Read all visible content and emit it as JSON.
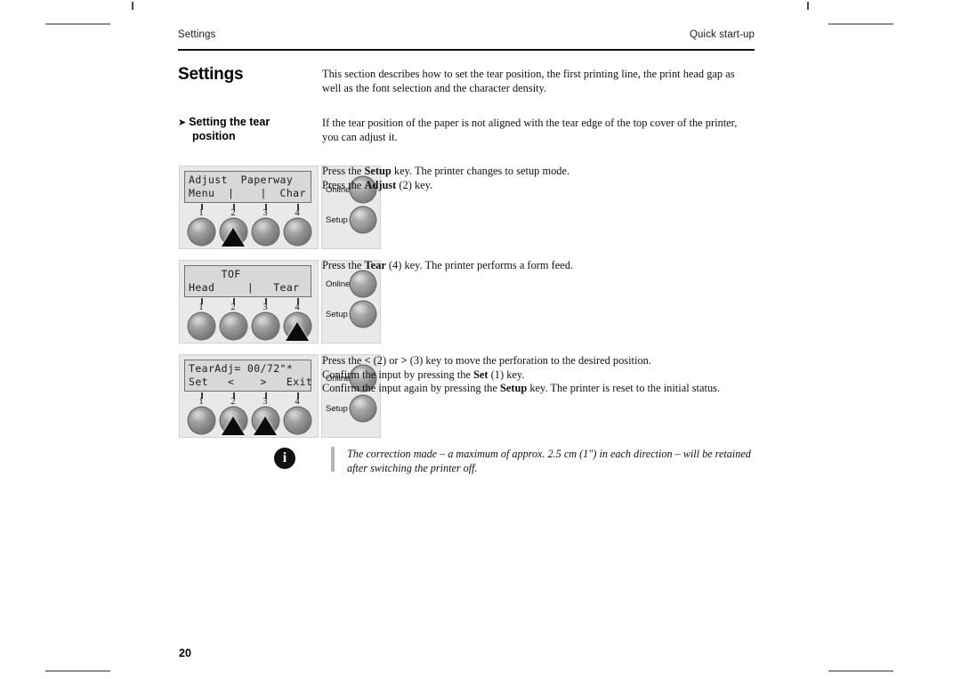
{
  "header": {
    "left": "Settings",
    "right": "Quick start-up"
  },
  "page_title": "Settings",
  "intro_text": "This section describes how to set the tear position, the first printing line, the print head gap as well as the font selection and the character density.",
  "section": {
    "arrow_glyph": "➤",
    "label_line1": "Setting the tear",
    "label_line2": "position",
    "description": "If the tear position of the paper is not aligned with the tear edge of the top cover of the printer, you can adjust it."
  },
  "steps": [
    {
      "panel": {
        "lcd_line1": "Adjust  Paperway",
        "lcd_line2": "Menu  |    |  Char",
        "button_numbers": [
          "1",
          "2",
          "3",
          "4"
        ],
        "pressed_button": "2",
        "side_buttons": [
          "Online",
          "Setup"
        ]
      },
      "instructions": [
        {
          "pre": "Press the ",
          "bold": "Setup",
          "post": " key. The printer changes to setup mode."
        },
        {
          "pre": "Press the ",
          "bold": "Adjust",
          "post": " (2) key."
        }
      ]
    },
    {
      "panel": {
        "lcd_line1": "     TOF",
        "lcd_line2": "Head     |   Tear",
        "button_numbers": [
          "1",
          "2",
          "3",
          "4"
        ],
        "pressed_button": "4",
        "side_buttons": [
          "Online",
          "Setup"
        ]
      },
      "instructions": [
        {
          "pre": "Press the ",
          "bold": "Tear",
          "post": " (4) key. The printer performs a form feed."
        }
      ]
    },
    {
      "panel": {
        "lcd_line1": "TearAdj= 00/72\"*",
        "lcd_line2": "Set   <    >   Exit",
        "button_numbers": [
          "1",
          "2",
          "3",
          "4"
        ],
        "pressed_button": "2,3",
        "side_buttons": [
          "Online",
          "Setup"
        ]
      },
      "instructions": [
        {
          "pre": "Press the ",
          "bold": "<",
          "post": " (2) or ",
          "bold2": ">",
          "post2": " (3) key to move the perforation to the desired position."
        },
        {
          "pre": "Confirm the input by pressing the ",
          "bold": "Set",
          "post": " (1) key."
        },
        {
          "pre": "Confirm the input again by pressing the ",
          "bold": "Setup",
          "post": " key. The printer is reset to the initial status."
        }
      ]
    }
  ],
  "note": {
    "icon": "info-icon",
    "icon_glyph": "i",
    "text": "The correction made – a maximum of approx. 2.5 cm (1\") in each direction – will be retained after switching the printer off."
  },
  "folio": "20",
  "colors": {
    "panel_bg": "#e9e9e9",
    "lcd_bg": "#d8d8d8",
    "rule": "#111111",
    "crop_mark": "#8f8f8f"
  }
}
